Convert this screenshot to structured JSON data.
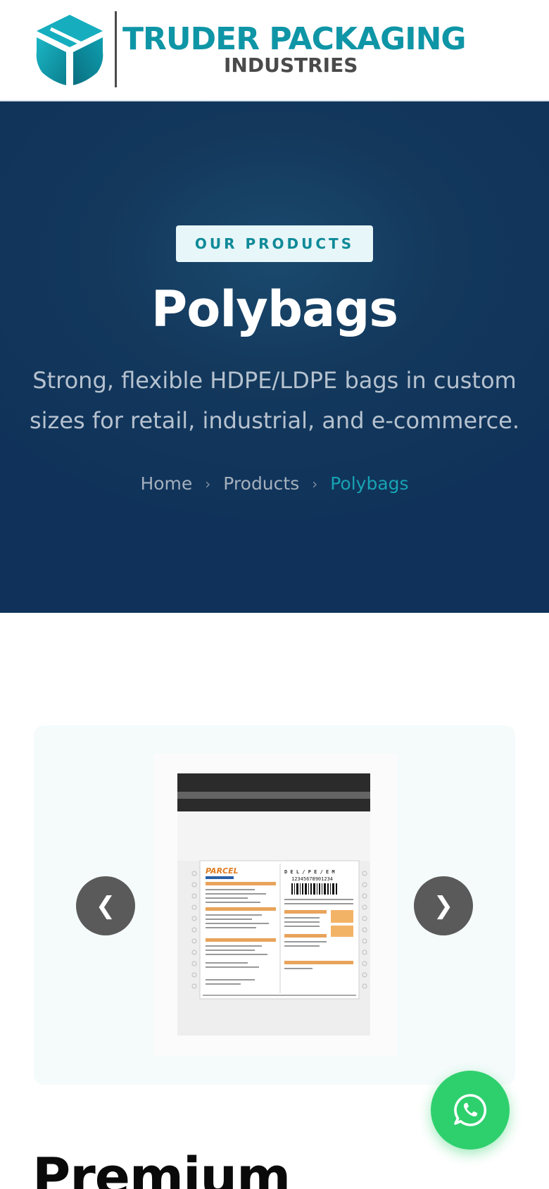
{
  "header": {
    "logo_title": "TRUDER PACKAGING",
    "logo_subtitle": "INDUSTRIES",
    "logo_icon": "cube-logo-icon",
    "brand_color": "#0e95a6"
  },
  "hero": {
    "badge": "OUR PRODUCTS",
    "title": "Polybags",
    "description": "Strong, flexible HDPE/LDPE bags in custom sizes for retail, industrial, and e-commerce.",
    "breadcrumb": [
      {
        "label": "Home"
      },
      {
        "label": "Products"
      },
      {
        "label": "Polybags"
      }
    ],
    "background_color": "#10325a",
    "accent_color": "#17a3b3"
  },
  "gallery": {
    "prev_label": "❮",
    "next_label": "❯",
    "image_icon": "courier-polybag-image",
    "label_text": {
      "brand": "PARCEL",
      "brand_sub": "EXPRESS",
      "tracking": "12345678901234",
      "zones": "D E L / P E / E M"
    }
  },
  "section": {
    "title": "Premium"
  },
  "whatsapp": {
    "icon": "whatsapp-icon",
    "color": "#2ed06d"
  }
}
